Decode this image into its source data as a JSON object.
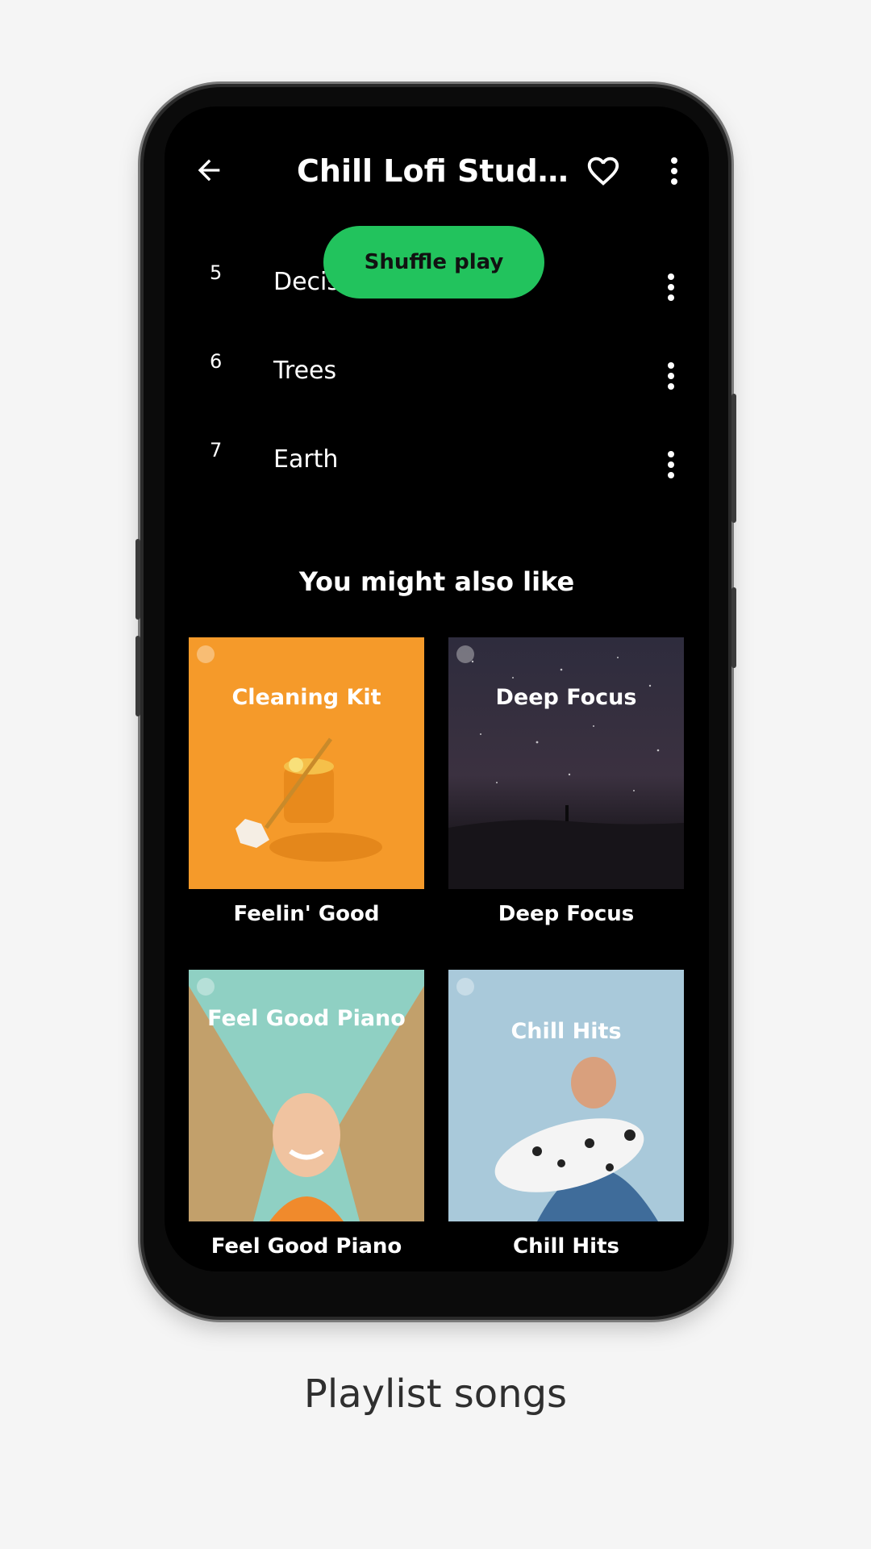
{
  "playlist": {
    "title": "Chill Lofi Study ..."
  },
  "shuffle_label": "Shuffle play",
  "tracks": [
    {
      "num": "5",
      "name": "Decis"
    },
    {
      "num": "6",
      "name": "Trees"
    },
    {
      "num": "7",
      "name": "Earth"
    }
  ],
  "recommend": {
    "heading": "You might also like",
    "cards": [
      {
        "art_title": "Cleaning Kit",
        "label": "Feelin' Good",
        "bg": "#f59a2a"
      },
      {
        "art_title": "Deep Focus",
        "label": "Deep Focus",
        "bg": "#2b2a37"
      },
      {
        "art_title": "Feel Good Piano",
        "label": "Feel Good Piano",
        "bg": "#8fd0c3"
      },
      {
        "art_title": "Chill Hits",
        "label": "Chill Hits",
        "bg": "#a9c9da"
      }
    ]
  },
  "caption": "Playlist songs",
  "colors": {
    "accent": "#22c35d",
    "screen": "#000000",
    "page": "#f5f5f5"
  },
  "icons": [
    "back-arrow-icon",
    "heart-icon",
    "more-vert-icon",
    "spotify-logo-icon"
  ]
}
